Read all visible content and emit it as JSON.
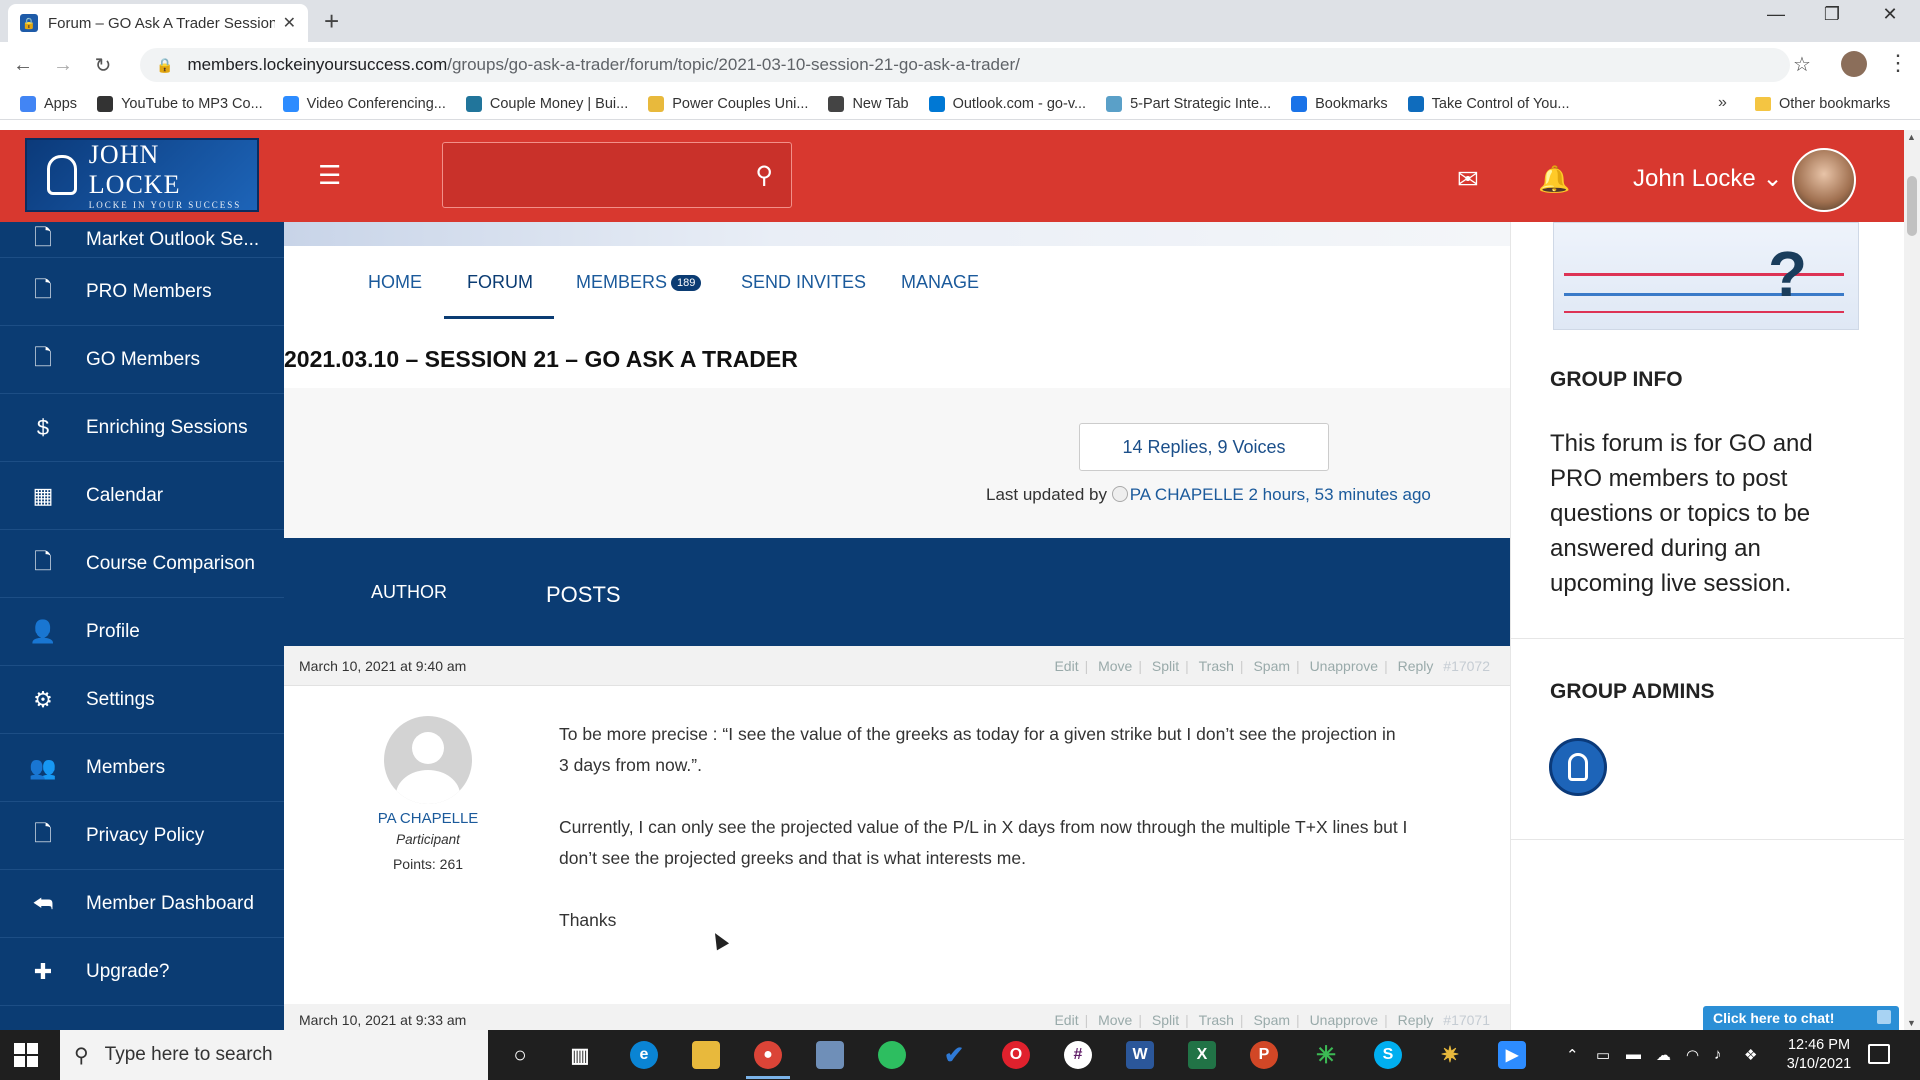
{
  "browser": {
    "tab_title": "Forum – GO Ask A Trader Session",
    "url_host": "members.lockeinyoursuccess.com",
    "url_path": "/groups/go-ask-a-trader/forum/topic/2021-03-10-session-21-go-ask-a-trader/",
    "bookmarks": [
      {
        "label": "Apps",
        "icon": "apps-icon",
        "color": "#4285f4"
      },
      {
        "label": "YouTube to MP3 Co...",
        "icon": "music-note-icon",
        "color": "#333333"
      },
      {
        "label": "Video Conferencing...",
        "icon": "zoom-icon",
        "color": "#2d8cff"
      },
      {
        "label": "Couple Money | Bui...",
        "icon": "wordpress-icon",
        "color": "#21759b"
      },
      {
        "label": "Power Couples Uni...",
        "icon": "page-icon",
        "color": "#e8b93c"
      },
      {
        "label": "New Tab",
        "icon": "globe-icon",
        "color": "#444444"
      },
      {
        "label": "Outlook.com - go-v...",
        "icon": "outlook-icon",
        "color": "#0078d4"
      },
      {
        "label": "5-Part Strategic Inte...",
        "icon": "circle-icon",
        "color": "#5aa0c8"
      },
      {
        "label": "Bookmarks",
        "icon": "star-icon",
        "color": "#1a73e8"
      },
      {
        "label": "Take Control of You...",
        "icon": "edge-icon",
        "color": "#0f6cbd"
      }
    ],
    "bookmarks_more": "»",
    "other_bookmarks": "Other bookmarks"
  },
  "site": {
    "logo_name": "JOHN LOCKE",
    "logo_tagline": "LOCKE IN YOUR SUCCESS",
    "user_name": "John Locke",
    "user_caret": "⌄"
  },
  "sidebar": {
    "items": [
      {
        "label": "Market Outlook Se...",
        "icon": "page-icon"
      },
      {
        "label": "PRO Members",
        "icon": "page-icon"
      },
      {
        "label": "GO Members",
        "icon": "page-icon"
      },
      {
        "label": "Enriching Sessions",
        "icon": "dollar-icon"
      },
      {
        "label": "Calendar",
        "icon": "calendar-icon"
      },
      {
        "label": "Course Comparison",
        "icon": "page-icon"
      },
      {
        "label": "Profile",
        "icon": "user-icon"
      },
      {
        "label": "Settings",
        "icon": "gears-icon"
      },
      {
        "label": "Members",
        "icon": "users-icon"
      },
      {
        "label": "Privacy Policy",
        "icon": "page-icon"
      },
      {
        "label": "Member Dashboard",
        "icon": "reply-all-icon"
      },
      {
        "label": "Upgrade?",
        "icon": "plus-icon"
      }
    ]
  },
  "subnav": {
    "home": "HOME",
    "forum": "FORUM",
    "members": "MEMBERS",
    "members_count": "189",
    "send_invites": "SEND INVITES",
    "manage": "MANAGE"
  },
  "topic": {
    "title": "2021.03.10 – SESSION 21 – GO ASK A TRADER",
    "replies_voices": "14 Replies, 9 Voices",
    "last_updated_prefix": "Last updated by",
    "last_updated_user": "PA CHAPELLE",
    "last_updated_time": "2 hours, 53 minutes ago"
  },
  "table_header": {
    "author": "AUTHOR",
    "posts": "POSTS"
  },
  "post_actions": [
    "Edit",
    "Move",
    "Split",
    "Trash",
    "Spam",
    "Unapprove",
    "Reply"
  ],
  "posts": [
    {
      "date": "March 10, 2021 at 9:40 am",
      "id": "#17072",
      "author": "PA CHAPELLE",
      "role": "Participant",
      "points": "Points: 261",
      "paragraphs": [
        "To be more precise : “I see the value of the greeks as today for a given strike but I don’t see the projection in 3 days from now.”.",
        "Currently, I can only see the projected value of the P/L in X days from now through the multiple T+X lines but I don’t see the projected greeks and that is what interests me.",
        "Thanks"
      ]
    },
    {
      "date": "March 10, 2021 at 9:33 am",
      "id": "#17071"
    }
  ],
  "right": {
    "group_info_title": "GROUP INFO",
    "group_info_text": "This forum is for GO and PRO members to post questions or topics to be answered during an upcoming live session.",
    "group_admins_title": "GROUP ADMINS"
  },
  "chat": {
    "label": "Click here to chat!"
  },
  "taskbar": {
    "search_placeholder": "Type here to search",
    "time": "12:46 PM",
    "date": "3/10/2021"
  }
}
